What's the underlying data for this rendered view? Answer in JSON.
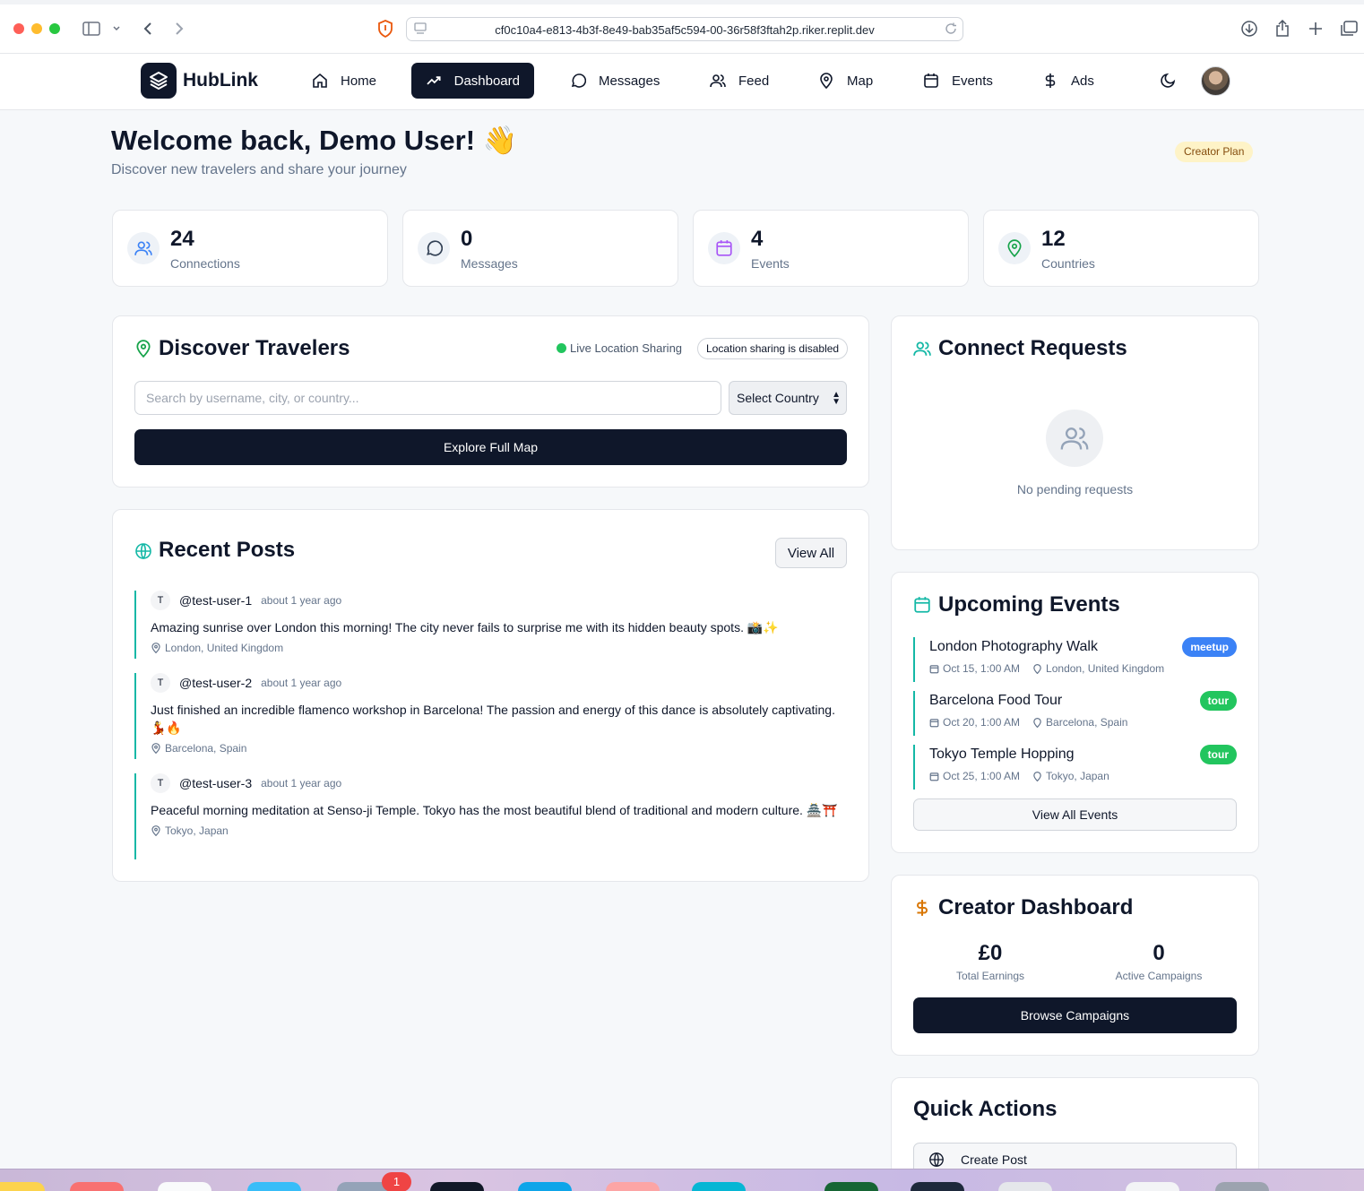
{
  "browser": {
    "url": "cf0c10a4-e813-4b3f-8e49-bab35af5c594-00-36r58f3ftah2p.riker.replit.dev"
  },
  "nav": {
    "logo": "HubLink",
    "items": [
      {
        "label": "Home",
        "icon": "home-icon"
      },
      {
        "label": "Dashboard",
        "icon": "trending-up-icon",
        "active": true
      },
      {
        "label": "Messages",
        "icon": "message-circle-icon"
      },
      {
        "label": "Feed",
        "icon": "users-icon"
      },
      {
        "label": "Map",
        "icon": "map-pin-icon"
      },
      {
        "label": "Events",
        "icon": "calendar-icon"
      },
      {
        "label": "Ads",
        "icon": "dollar-icon"
      }
    ]
  },
  "welcome": {
    "title": "Welcome back, Demo User! 👋",
    "subtitle": "Discover new travelers and share your journey",
    "plan_badge": "Creator Plan"
  },
  "stats": [
    {
      "value": "24",
      "label": "Connections",
      "icon": "users-icon",
      "color": "#3b82f6"
    },
    {
      "value": "0",
      "label": "Messages",
      "icon": "message-circle-icon",
      "color": "#334155"
    },
    {
      "value": "4",
      "label": "Events",
      "icon": "calendar-icon",
      "color": "#a855f7"
    },
    {
      "value": "12",
      "label": "Countries",
      "icon": "map-pin-icon",
      "color": "#16a34a"
    }
  ],
  "discover": {
    "title": "Discover Travelers",
    "live_label": "Live Location Sharing",
    "location_badge": "Location sharing is disabled",
    "search_placeholder": "Search by username, city, or country...",
    "country_select": "Select Country",
    "explore_button": "Explore Full Map"
  },
  "recent_posts": {
    "title": "Recent Posts",
    "view_all": "View All",
    "posts": [
      {
        "avatar": "T",
        "user": "@test-user-1",
        "time": "about 1 year ago",
        "content": "Amazing sunrise over London this morning! The city never fails to surprise me with its hidden beauty spots. 📸✨",
        "location": "London, United Kingdom"
      },
      {
        "avatar": "T",
        "user": "@test-user-2",
        "time": "about 1 year ago",
        "content": "Just finished an incredible flamenco workshop in Barcelona! The passion and energy of this dance is absolutely captivating. 💃🔥",
        "location": "Barcelona, Spain"
      },
      {
        "avatar": "T",
        "user": "@test-user-3",
        "time": "about 1 year ago",
        "content": "Peaceful morning meditation at Senso-ji Temple. Tokyo has the most beautiful blend of traditional and modern culture. 🏯⛩️",
        "location": "Tokyo, Japan"
      }
    ]
  },
  "connect_requests": {
    "title": "Connect Requests",
    "empty_text": "No pending requests"
  },
  "upcoming_events": {
    "title": "Upcoming Events",
    "view_all": "View All Events",
    "events": [
      {
        "name": "London Photography Walk",
        "date": "Oct 15, 1:00 AM",
        "location": "London, United Kingdom",
        "tag": "meetup",
        "tag_color": "#3b82f6"
      },
      {
        "name": "Barcelona Food Tour",
        "date": "Oct 20, 1:00 AM",
        "location": "Barcelona, Spain",
        "tag": "tour",
        "tag_color": "#22c55e"
      },
      {
        "name": "Tokyo Temple Hopping",
        "date": "Oct 25, 1:00 AM",
        "location": "Tokyo, Japan",
        "tag": "tour",
        "tag_color": "#22c55e"
      }
    ]
  },
  "creator": {
    "title": "Creator Dashboard",
    "earnings_value": "£0",
    "earnings_label": "Total Earnings",
    "campaigns_value": "0",
    "campaigns_label": "Active Campaigns",
    "browse_button": "Browse Campaigns"
  },
  "quick_actions": {
    "title": "Quick Actions",
    "items": [
      {
        "label": "Create Post",
        "icon": "globe-icon"
      }
    ]
  },
  "dock": {
    "badge": "1"
  }
}
